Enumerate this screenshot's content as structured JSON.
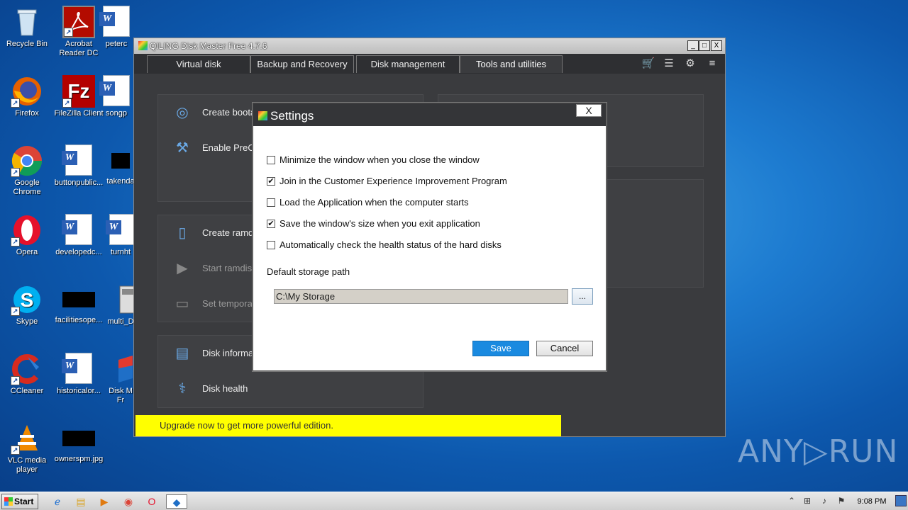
{
  "desktop": {
    "icons": [
      {
        "label": "Recycle Bin",
        "icon": "recycle-bin-icon"
      },
      {
        "label": "Acrobat Reader DC",
        "icon": "acrobat-icon"
      },
      {
        "label": "peterc",
        "icon": "word-doc-icon"
      },
      {
        "label": "Firefox",
        "icon": "firefox-icon"
      },
      {
        "label": "FileZilla Client",
        "icon": "filezilla-icon"
      },
      {
        "label": "songp",
        "icon": "word-doc-icon"
      },
      {
        "label": "Google Chrome",
        "icon": "chrome-icon"
      },
      {
        "label": "buttonpublic...",
        "icon": "word-doc-icon"
      },
      {
        "label": "takenda",
        "icon": "black-file-icon"
      },
      {
        "label": "Opera",
        "icon": "opera-icon"
      },
      {
        "label": "developedc...",
        "icon": "word-doc-icon"
      },
      {
        "label": "turnht",
        "icon": "word-doc-icon"
      },
      {
        "label": "Skype",
        "icon": "skype-icon"
      },
      {
        "label": "facilitiesope...",
        "icon": "black-file-icon"
      },
      {
        "label": "multi_D",
        "icon": "installer-icon"
      },
      {
        "label": "CCleaner",
        "icon": "ccleaner-icon"
      },
      {
        "label": "historicalor...",
        "icon": "word-doc-icon"
      },
      {
        "label": "Disk M Fr",
        "icon": "qiling-icon"
      },
      {
        "label": "VLC media player",
        "icon": "vlc-icon"
      },
      {
        "label": "ownerspm.jpg",
        "icon": "black-file-icon"
      }
    ]
  },
  "app": {
    "title": "QILING Disk Master Free 4.7.6",
    "window_buttons": {
      "minimize": "_",
      "maximize": "□",
      "close": "X"
    },
    "tabs": [
      {
        "label": "Virtual disk",
        "active": false
      },
      {
        "label": "Backup and Recovery",
        "active": false
      },
      {
        "label": "Disk management",
        "active": false
      },
      {
        "label": "Tools and utilities",
        "active": true
      }
    ],
    "toolbar_icons": [
      "cart-icon",
      "list-icon",
      "gear-icon",
      "menu-icon"
    ],
    "panel_items": [
      {
        "label": "Create boota",
        "icon": "disc-icon",
        "dim": false
      },
      {
        "label": "Enable PreO",
        "icon": "tools-icon",
        "dim": false
      },
      {
        "label": "Create ramd",
        "icon": "sd-card-icon",
        "dim": false
      },
      {
        "label": "Start ramdis",
        "icon": "play-icon",
        "dim": true
      },
      {
        "label": "Set tempora",
        "icon": "monitor-gear-icon",
        "dim": true
      },
      {
        "label": "Disk informa",
        "icon": "disk-info-icon",
        "dim": false
      },
      {
        "label": "Disk health",
        "icon": "stethoscope-icon",
        "dim": false
      }
    ],
    "upgrade_banner": "Upgrade now to get more powerful edition."
  },
  "settings": {
    "title": "Settings",
    "close_label": "X",
    "options": [
      {
        "label": "Minimize the window when you close the window",
        "checked": false
      },
      {
        "label": "Join in the Customer Experience Improvement Program",
        "checked": true
      },
      {
        "label": "Load the Application when the computer starts",
        "checked": false
      },
      {
        "label": "Save the window's size when you exit application",
        "checked": true
      },
      {
        "label": "Automatically check the health status of the hard disks",
        "checked": false
      }
    ],
    "storage_label": "Default storage path",
    "storage_path": "C:\\My Storage",
    "browse_label": "...",
    "save_label": "Save",
    "cancel_label": "Cancel",
    "check_mark": "✔"
  },
  "taskbar": {
    "start_label": "Start",
    "apps": [
      "ie-icon",
      "explorer-icon",
      "media-player-icon",
      "chrome-icon",
      "opera-icon",
      "qiling-icon"
    ],
    "tray_icons": [
      "chevron-up-icon",
      "network-icon",
      "speaker-icon",
      "flag-icon"
    ],
    "clock": "9:08 PM"
  },
  "watermark": "ANY▷RUN"
}
